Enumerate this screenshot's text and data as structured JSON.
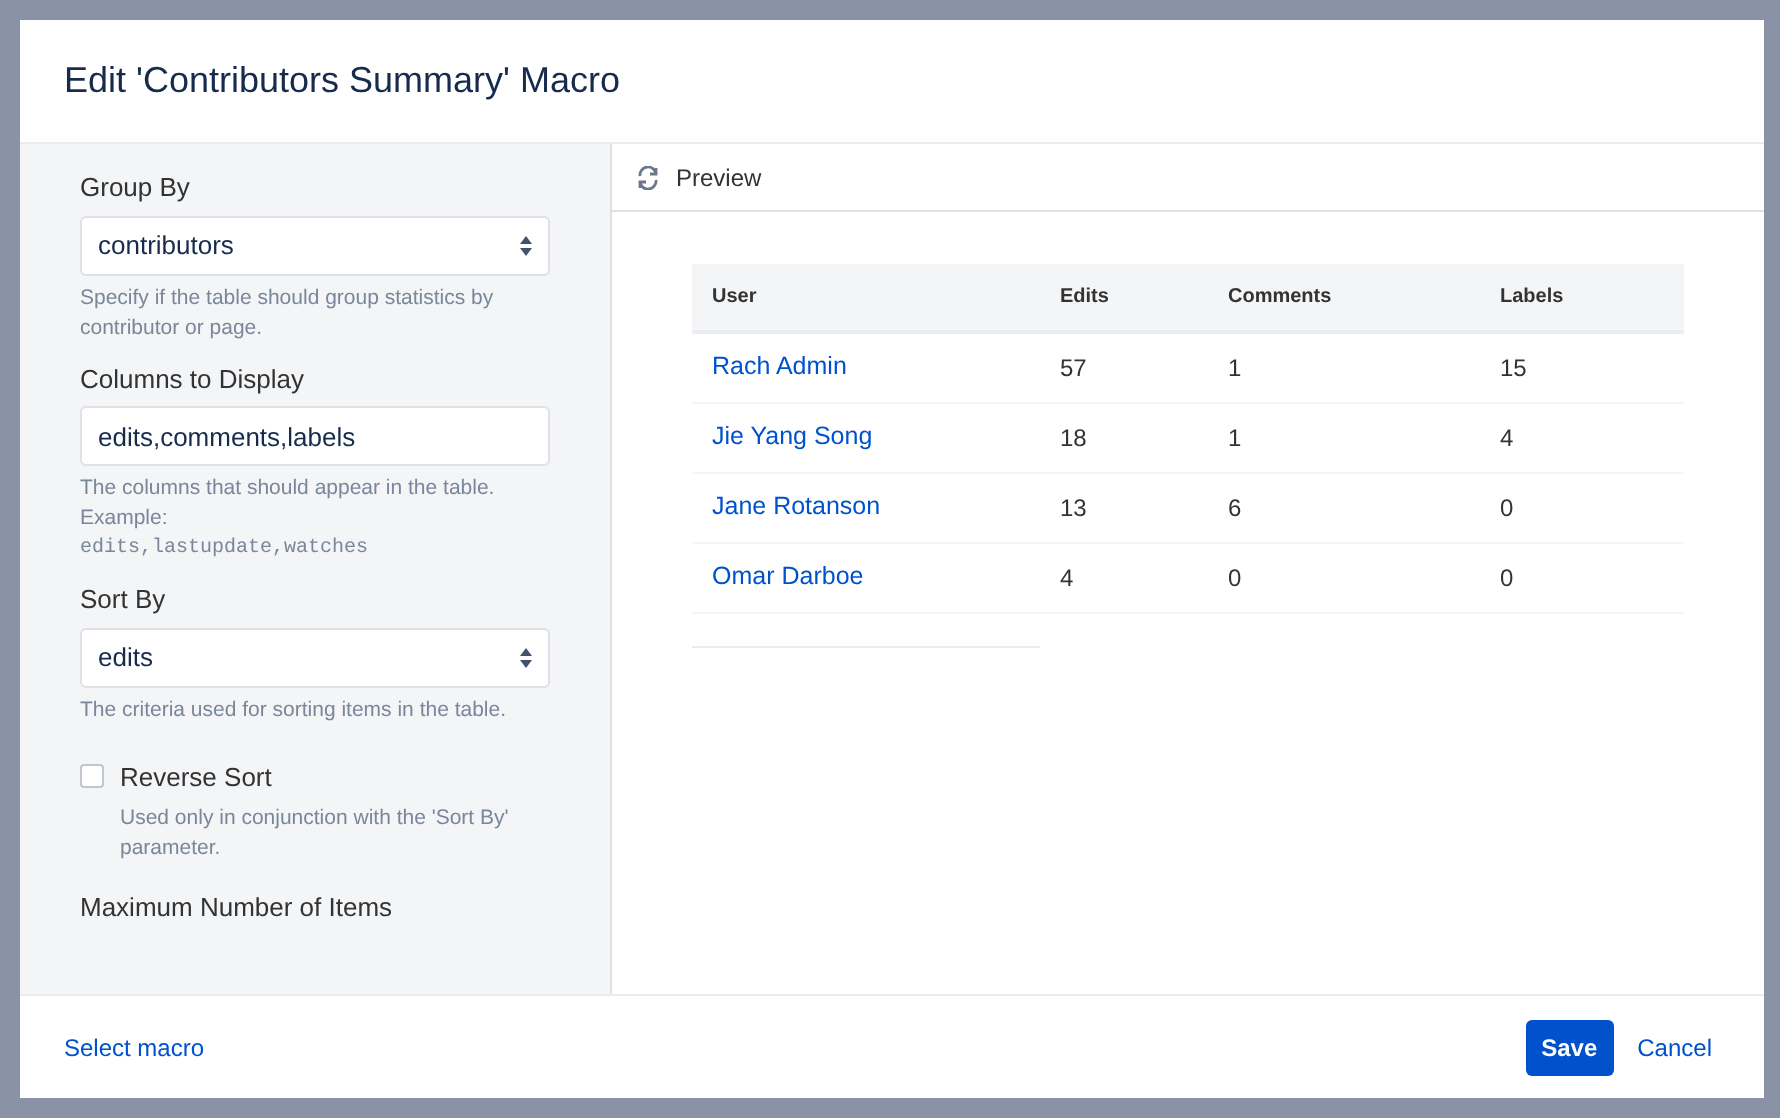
{
  "dialog": {
    "title": "Edit 'Contributors Summary' Macro"
  },
  "form": {
    "fields": [
      {
        "kind": "select",
        "label": "Group By",
        "value": "contributors",
        "help": "Specify if the table should group statistics by contributor or page."
      },
      {
        "kind": "text",
        "label": "Columns to Display",
        "value": "edits,comments,labels",
        "help": "The columns that should appear in the table. Example:",
        "help_code": "edits,lastupdate,watches"
      },
      {
        "kind": "select",
        "label": "Sort By",
        "value": "edits",
        "help": "The criteria used for sorting items in the table."
      },
      {
        "kind": "checkbox",
        "label": "Reverse Sort",
        "checked": false,
        "help": "Used only in conjunction with the 'Sort By' parameter."
      },
      {
        "kind": "heading",
        "label": "Maximum Number of Items"
      }
    ]
  },
  "preview": {
    "title": "Preview",
    "table": {
      "columns": [
        "User",
        "Edits",
        "Comments",
        "Labels"
      ],
      "rows": [
        [
          "Rach Admin",
          "57",
          "1",
          "15"
        ],
        [
          "Jie Yang Song",
          "18",
          "1",
          "4"
        ],
        [
          "Jane Rotanson",
          "13",
          "6",
          "0"
        ],
        [
          "Omar Darboe",
          "4",
          "0",
          "0"
        ]
      ]
    }
  },
  "footer": {
    "link": "Select macro",
    "save": "Save",
    "cancel": "Cancel"
  }
}
